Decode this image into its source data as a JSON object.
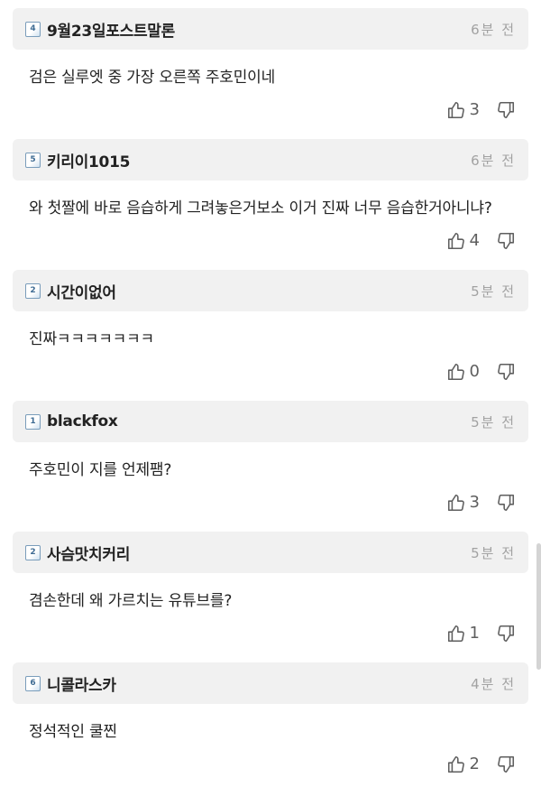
{
  "comments": [
    {
      "level": "4",
      "author": "9월23일포스트말론",
      "time": "6분 전",
      "text": "검은 실루엣 중 가장 오른쪽 주호민이네",
      "likes": "3"
    },
    {
      "level": "5",
      "author": "키리이1015",
      "time": "6분 전",
      "text": "와 첫짤에 바로 음습하게 그려놓은거보소 이거 진짜 너무 음습한거아니냐?",
      "likes": "4"
    },
    {
      "level": "2",
      "author": "시간이없어",
      "time": "5분 전",
      "text": "진짜ㅋㅋㅋㅋㅋㅋㅋ",
      "likes": "0"
    },
    {
      "level": "1",
      "author": "blackfox",
      "time": "5분 전",
      "text": "주호민이 지를 언제팸?",
      "likes": "3"
    },
    {
      "level": "2",
      "author": "사슴맛치커리",
      "time": "5분 전",
      "text": "겸손한데 왜 가르치는 유튜브를?",
      "likes": "1"
    },
    {
      "level": "6",
      "author": "니콜라스카",
      "time": "4분 전",
      "text": "정석적인 쿨찐",
      "likes": "2"
    }
  ],
  "colors": {
    "header_bg": "#f1f1f1",
    "text": "#222222",
    "muted": "#a2a2a2",
    "badge_border": "#7a9dbb"
  },
  "icons": {
    "like": "thumbs-up-icon",
    "dislike": "thumbs-down-icon",
    "level": "level-badge-icon"
  }
}
